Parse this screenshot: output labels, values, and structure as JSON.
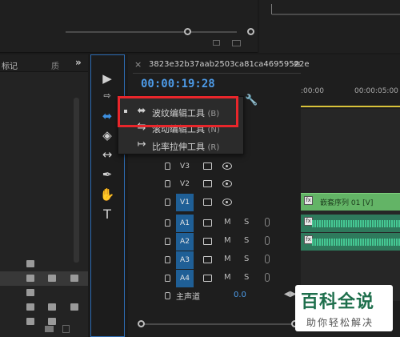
{
  "project_panel": {
    "tab_label": "标记",
    "tab_next": "质",
    "overflow": "»"
  },
  "tools": {
    "items": [
      "selection",
      "track-select",
      "ripple-edit",
      "razor",
      "slip",
      "pen",
      "hand",
      "type"
    ],
    "type_label": "T"
  },
  "timeline": {
    "sequence_name": "3823e32b37aab2503ca81ca46959522e",
    "menu_glyph": "≡",
    "close_glyph": "×",
    "timecode": "00:00:19:28",
    "ruler_labels": [
      ":00:00",
      "00:00:05:00"
    ],
    "video_tracks": [
      "V3",
      "V2",
      "V1"
    ],
    "audio_tracks": [
      "A1",
      "A2",
      "A3",
      "A4"
    ],
    "audio_m": "M",
    "audio_s": "S",
    "master_label": "主声道",
    "master_value": "0.0",
    "video_clip_label": "嵌套序列 01 [V]",
    "fx_label": "fx"
  },
  "popup_menu": {
    "items": [
      {
        "label": "波纹编辑工具",
        "shortcut": "(B)"
      },
      {
        "label": "滚动编辑工具",
        "shortcut": "(N)"
      },
      {
        "label": "比率拉伸工具",
        "shortcut": "(R)"
      }
    ]
  },
  "watermark": {
    "title": "百科全说",
    "subtitle": "助你轻松解决"
  },
  "colors": {
    "accent_blue": "#2d6cb3",
    "timecode": "#4d9be8",
    "highlight_red": "#e8262b",
    "video_clip": "#63b466",
    "audio_clip": "#2e7a5c"
  }
}
